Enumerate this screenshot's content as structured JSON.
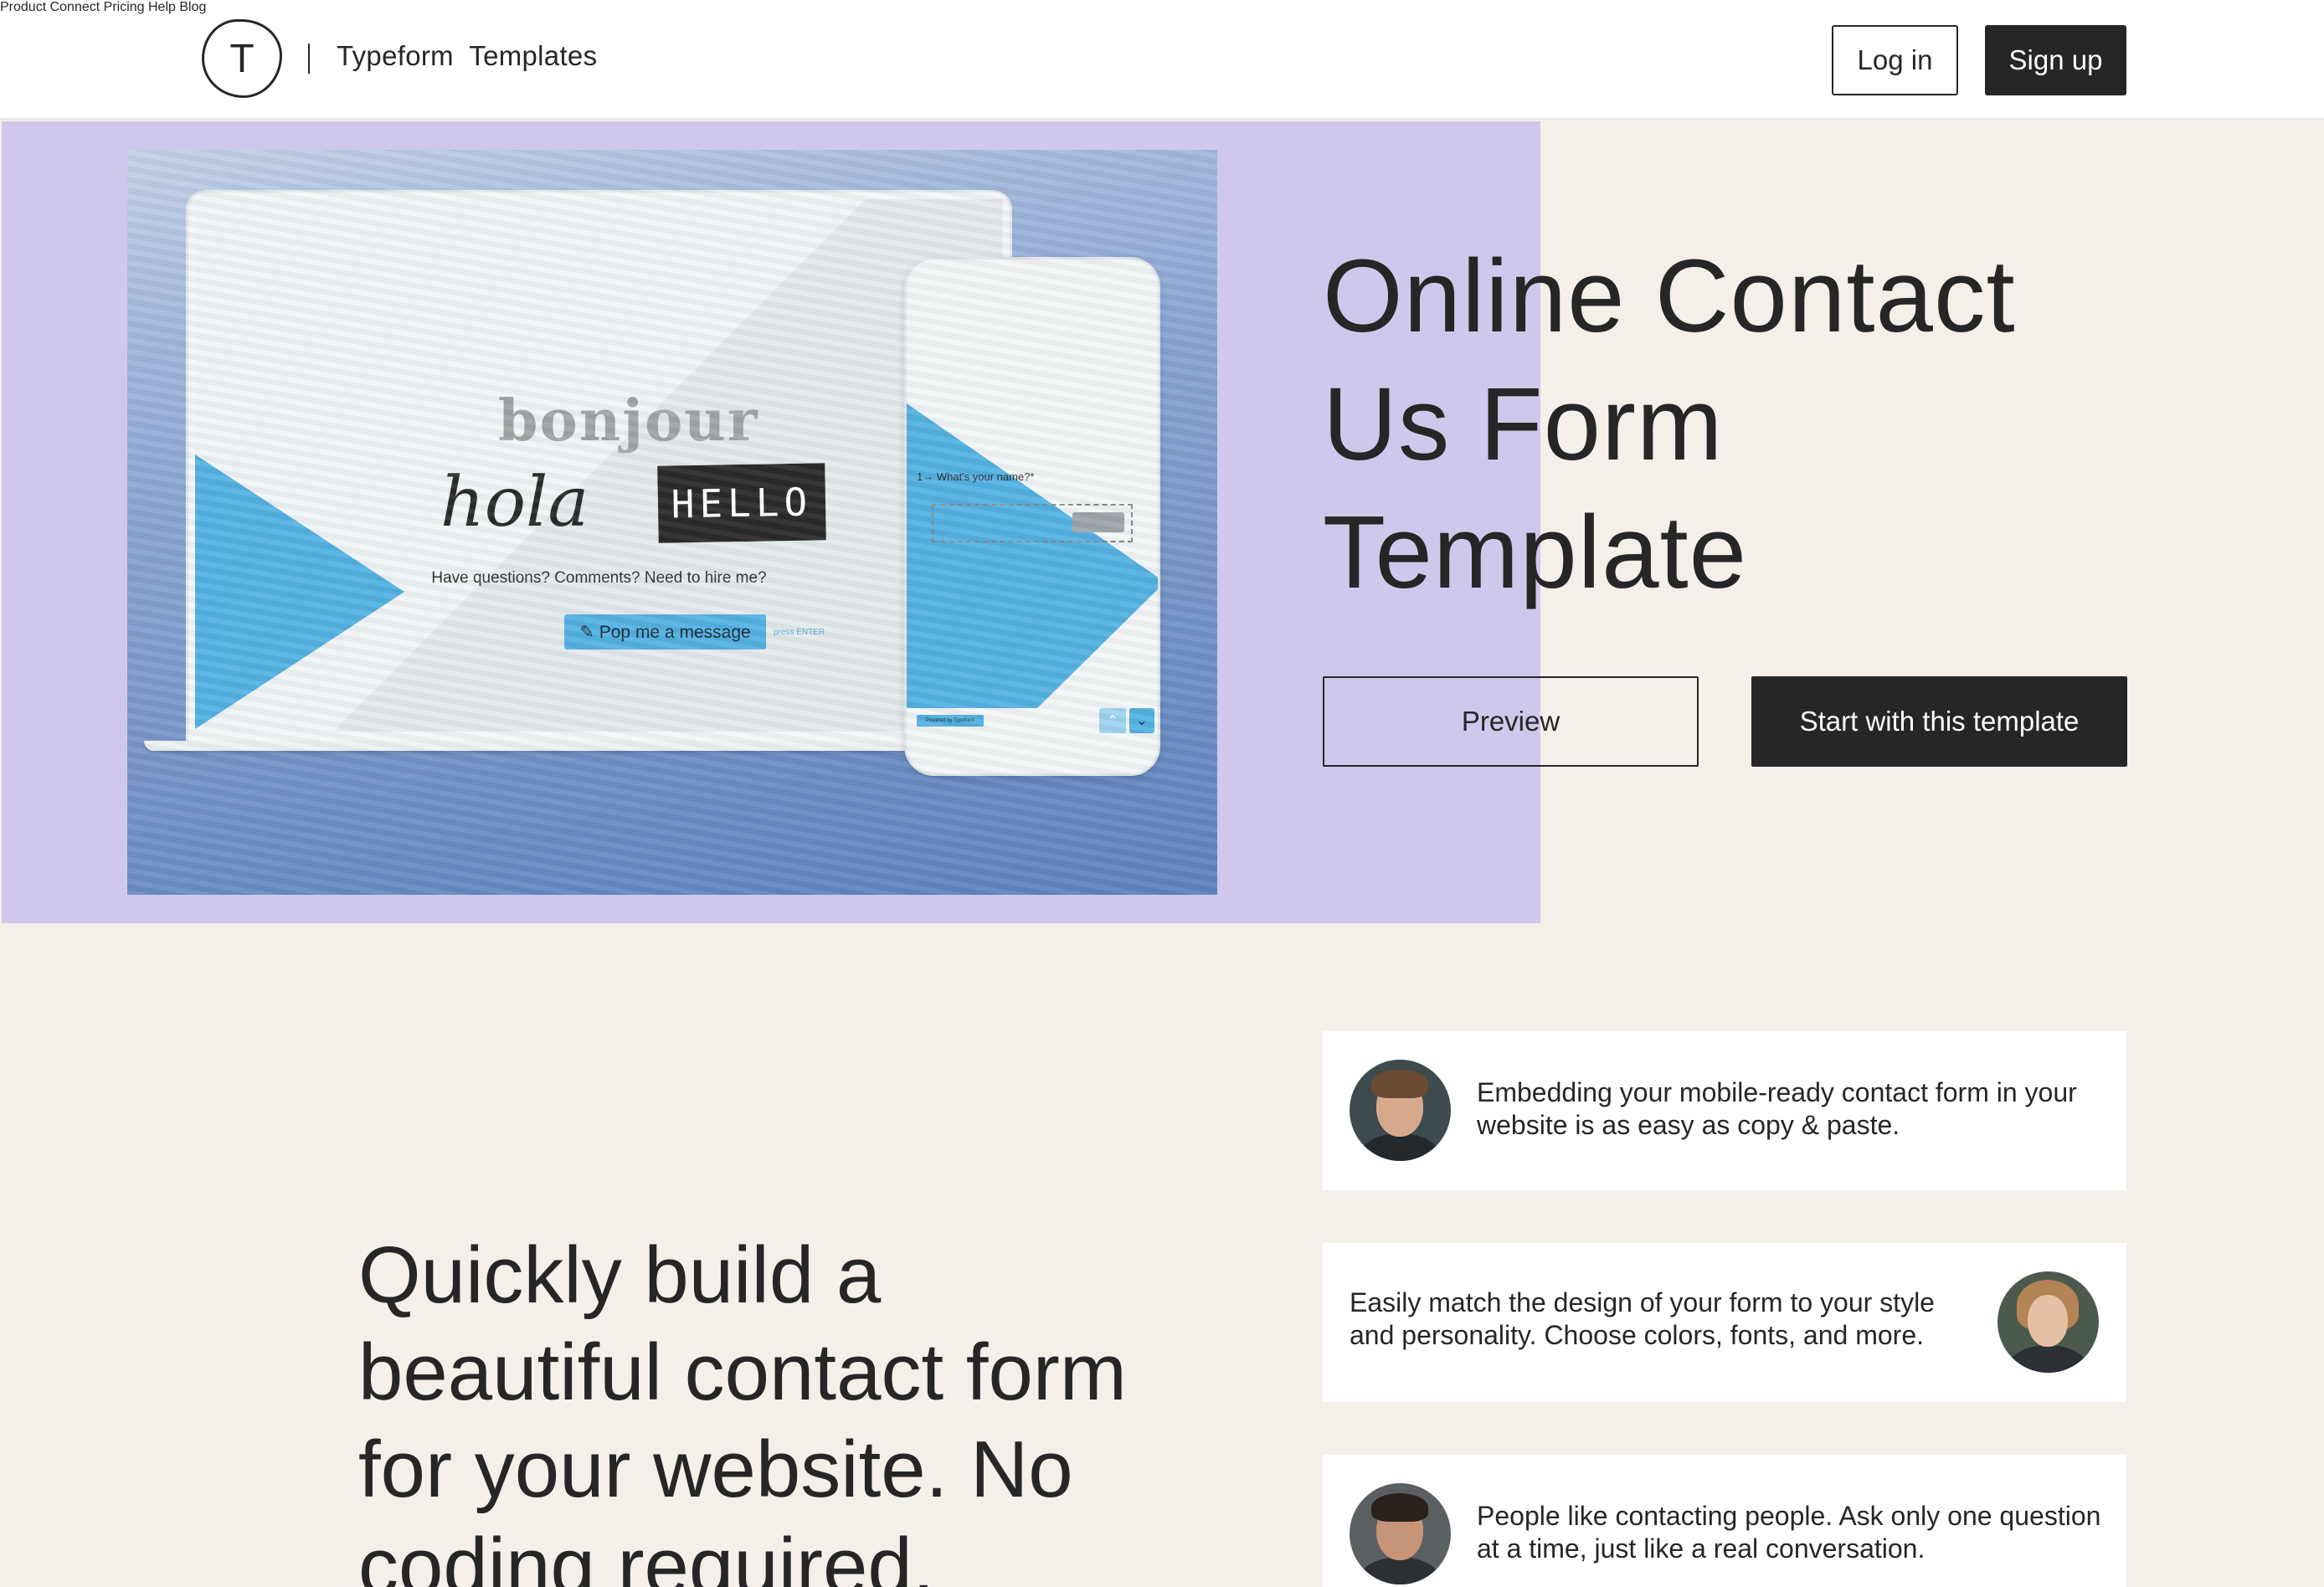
{
  "header": {
    "logo_letter": "T",
    "brand": "Typeform  Templates",
    "nav": [
      "Product",
      "Connect",
      "Pricing",
      "Help",
      "Blog"
    ],
    "login_label": "Log in",
    "signup_label": "Sign up"
  },
  "hero": {
    "title_lines": [
      "Online Contact",
      "Us Form",
      "Template"
    ],
    "preview_label": "Preview",
    "start_label": "Start with this template",
    "mockup": {
      "bonjour": "bonjour",
      "hola": "hola",
      "hello": "HELLO",
      "question": "Have questions? Comments? Need to hire me?",
      "cta": "✎ Pop me a message",
      "press_enter": "press ENTER",
      "phone_question": "1→  What's your name?*",
      "powered_by": "Powered by Typeform"
    }
  },
  "section": {
    "title_lines": [
      "Quickly build a",
      "beautiful contact form",
      "for your website. No",
      "coding required."
    ],
    "cards": [
      {
        "text_lines": [
          "Embedding your mobile-ready contact form in your",
          "website is as easy as copy & paste."
        ],
        "avatar": "male-avatar"
      },
      {
        "text_lines": [
          "Easily match the design of your form to your style",
          "and personality. Choose colors, fonts, and more."
        ],
        "avatar": "female-avatar"
      },
      {
        "text_lines": [
          "People like contacting people. Ask only one question",
          "at a time, just like a real conversation."
        ],
        "avatar": "male-bearded-avatar"
      }
    ]
  },
  "colors": {
    "dark": "#262627",
    "hero_purple": "#d0c8ec",
    "cream": "#f4efe9",
    "accent_blue": "#54b2e2"
  }
}
